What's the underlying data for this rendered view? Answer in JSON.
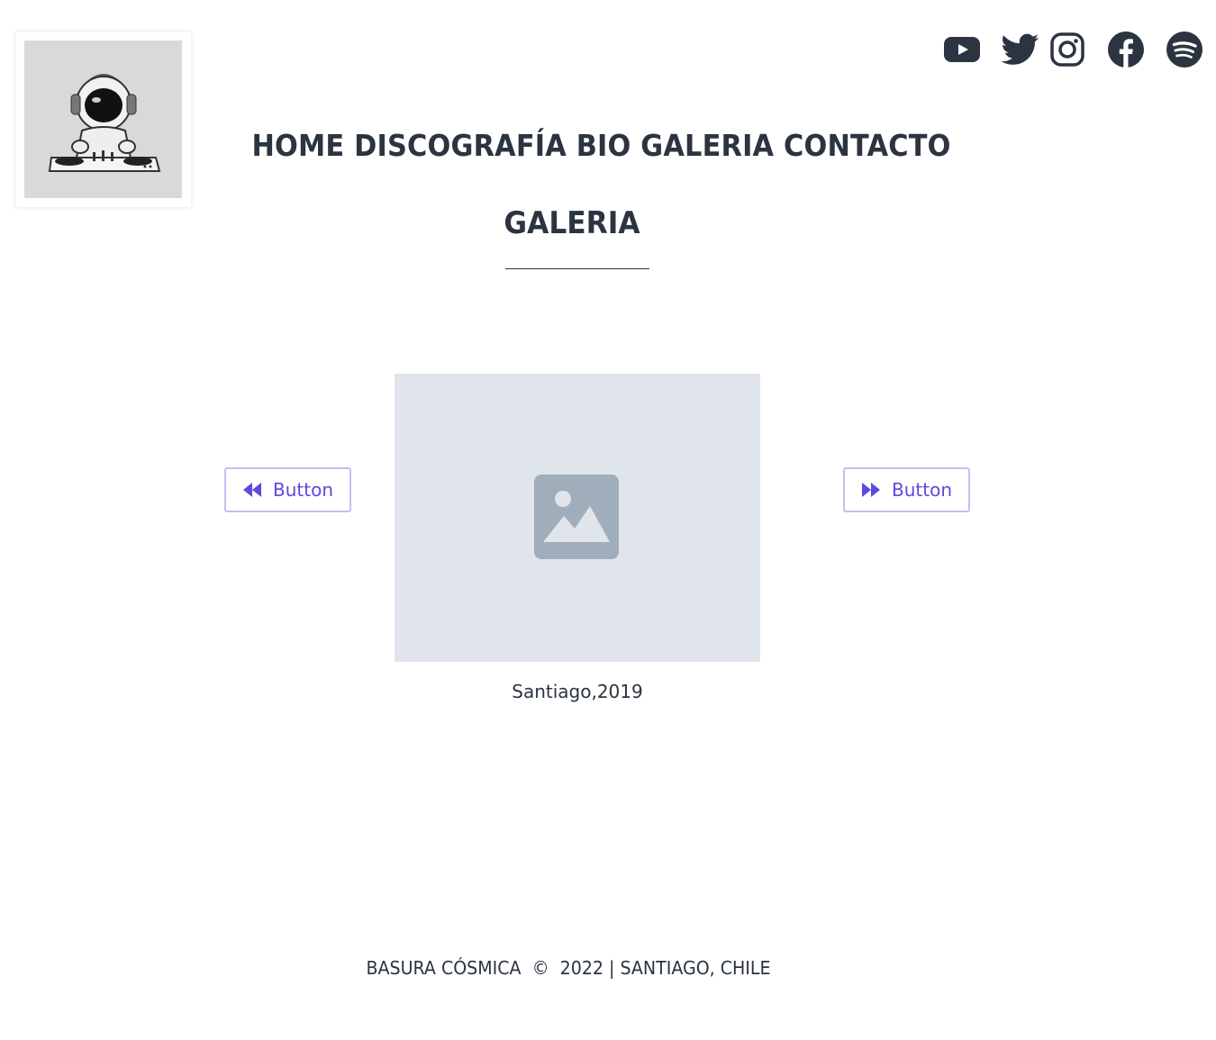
{
  "header": {
    "logo_icon": "astronaut-dj-icon",
    "social": [
      {
        "name": "youtube-icon"
      },
      {
        "name": "twitter-icon"
      },
      {
        "name": "instagram-icon"
      },
      {
        "name": "facebook-icon"
      },
      {
        "name": "spotify-icon"
      }
    ]
  },
  "nav": {
    "items": [
      "HOME",
      "DISCOGRAFÍA",
      "BIO",
      "GALERIA",
      "CONTACTO"
    ]
  },
  "main": {
    "title": "GALERIA",
    "image_icon": "image-placeholder-icon",
    "caption": "Santiago,2019",
    "prev_button": {
      "label": "Button",
      "icon": "rewind-icon"
    },
    "next_button": {
      "label": "Button",
      "icon": "fast-forward-icon"
    }
  },
  "footer": {
    "text": "BASURA CÓSMICA  ©  2022 | SANTIAGO, CHILE"
  },
  "colors": {
    "text": "#2b3440",
    "accent": "#5b4bde",
    "button_border": "#c5bdf7",
    "placeholder_bg": "#e0e5ec",
    "placeholder_icon": "#a0aebb"
  }
}
